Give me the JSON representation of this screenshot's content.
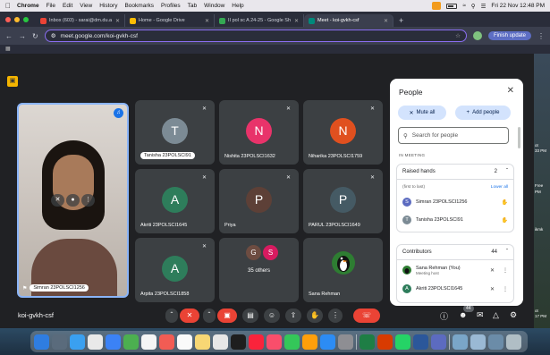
{
  "menubar": {
    "app": "Chrome",
    "items": [
      "File",
      "Edit",
      "View",
      "History",
      "Bookmarks",
      "Profiles",
      "Tab",
      "Window",
      "Help"
    ],
    "datetime": "Fri 22 Nov  12:48 PM"
  },
  "tabs": [
    {
      "title": "Inbox (603) - sarai@dm.du.a",
      "color": "#ea4335"
    },
    {
      "title": "Home - Google Drive",
      "color": "#fbbc04"
    },
    {
      "title": "II pol sc A 24-25 - Google Sh",
      "color": "#34a853"
    },
    {
      "title": "Meet - koi-gvkh-csf",
      "color": "#00897b",
      "active": true
    }
  ],
  "address": {
    "url": "meet.google.com/koi-gvkh-csf",
    "finish_update": "Finish update"
  },
  "bookmarks_icon": "apps-grid-icon",
  "self_tile": {
    "name": "Simran 23POLSCI1256"
  },
  "tiles": [
    {
      "initial": "T",
      "name": "Tanisha 23POLSCI91",
      "color": "#7c8b95",
      "pill": true
    },
    {
      "initial": "N",
      "name": "Nishita 23POLSCI1632",
      "color": "#e8336a"
    },
    {
      "initial": "N",
      "name": "Niharika 23POLSCI1759",
      "color": "#e0501f"
    },
    {
      "initial": "A",
      "name": "Akriti 23POLSCI1645",
      "color": "#2e7d5b"
    },
    {
      "initial": "P",
      "name": "Priya",
      "color": "#5d4037"
    },
    {
      "initial": "P",
      "name": "PARUL 23POLSCI1649",
      "color": "#455a64"
    },
    {
      "initial": "A",
      "name": "Arpita 23POLSCI1858",
      "color": "#2e7d5b"
    },
    {
      "others": true,
      "initials": [
        "G",
        "S"
      ],
      "colors": [
        "#6d4c41",
        "#d81b60"
      ],
      "label": "35 others"
    },
    {
      "bird": true,
      "name": "Sana Rehman"
    }
  ],
  "meeting": {
    "code": "koi-gvkh-csf",
    "participant_count": "44"
  },
  "people_panel": {
    "title": "People",
    "mute_all": "Mute all",
    "add_people": "Add people",
    "search_placeholder": "Search for people",
    "in_meeting": "IN MEETING",
    "raised_hands": {
      "label": "Raised hands",
      "count": "2",
      "first_to_last": "(first to last)",
      "lower_all": "Lower all",
      "people": [
        {
          "initial": "S",
          "name": "Simran 23POLSCI1256",
          "color": "#5c6bc0"
        },
        {
          "initial": "T",
          "name": "Tanisha 23POLSCI91",
          "color": "#7c8b95"
        }
      ]
    },
    "contributors": {
      "label": "Contributors",
      "count": "44",
      "people": [
        {
          "name": "Sana Rehman (You)",
          "sub": "Meeting host",
          "bird": true
        },
        {
          "initial": "A",
          "name": "Akriti 23POLSCI1645",
          "color": "#2e7d5b"
        }
      ]
    }
  },
  "desktop_edge": [
    "ot",
    "33 PM",
    "Free",
    "PM",
    "ikmk",
    "ot",
    "17 PM"
  ]
}
